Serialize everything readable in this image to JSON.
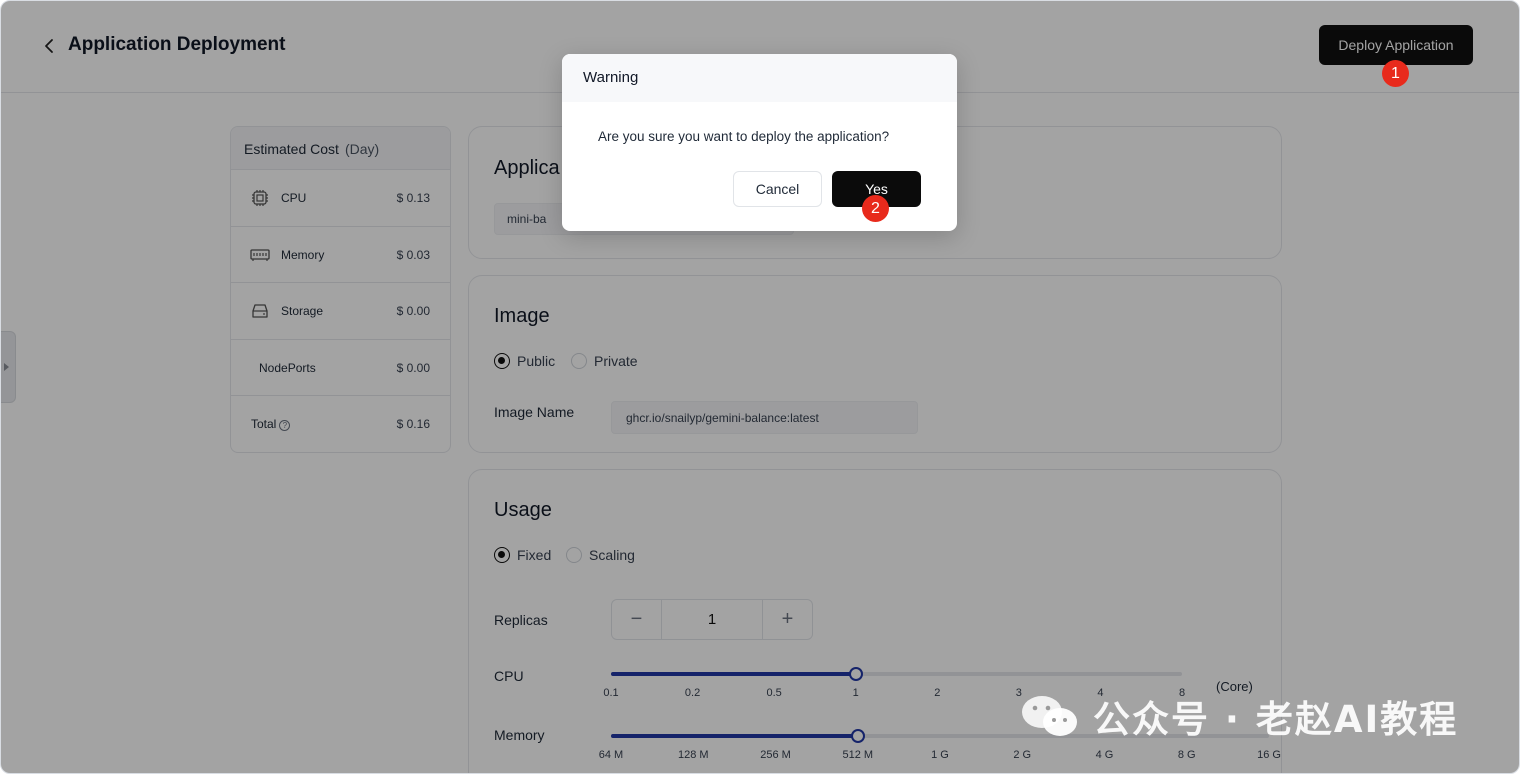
{
  "header": {
    "title": "Application Deployment",
    "deploy_label": "Deploy Application"
  },
  "cost": {
    "title": "Estimated Cost",
    "unit": "(Day)",
    "rows": [
      {
        "label": "CPU",
        "value": "$ 0.13",
        "icon": "cpu-chip-icon"
      },
      {
        "label": "Memory",
        "value": "$ 0.03",
        "icon": "memory-module-icon"
      },
      {
        "label": "Storage",
        "value": "$ 0.00",
        "icon": "storage-drive-icon"
      },
      {
        "label": "NodePorts",
        "value": "$ 0.00"
      },
      {
        "label": "Total",
        "value": "$ 0.16",
        "icon": "help-circle-icon"
      }
    ]
  },
  "app_card": {
    "title": "Applica",
    "name_value": "mini-ba"
  },
  "image_card": {
    "title": "Image",
    "public_label": "Public",
    "private_label": "Private",
    "selected": "Public",
    "image_name_label": "Image Name",
    "image_name_value": "ghcr.io/snailyp/gemini-balance:latest"
  },
  "usage_card": {
    "title": "Usage",
    "fixed_label": "Fixed",
    "scaling_label": "Scaling",
    "selected": "Fixed",
    "replicas_label": "Replicas",
    "replicas_value": "1",
    "cpu_label": "CPU",
    "cpu_unit": "(Core)",
    "cpu_ticks": [
      "0.1",
      "0.2",
      "0.5",
      "1",
      "2",
      "3",
      "4",
      "8"
    ],
    "cpu_selected": "1",
    "memory_label": "Memory",
    "memory_ticks": [
      "64 M",
      "128 M",
      "256 M",
      "512 M",
      "1 G",
      "2 G",
      "4 G",
      "8 G",
      "16 G"
    ],
    "memory_selected": "512 M"
  },
  "modal": {
    "title": "Warning",
    "message": "Are you sure you want to deploy the application?",
    "cancel_label": "Cancel",
    "yes_label": "Yes"
  },
  "badges": {
    "step1": "1",
    "step2": "2"
  },
  "watermark": {
    "text": "公众号 · 老赵AI教程"
  },
  "colors": {
    "accent": "#2137a6",
    "primary_button": "#111111",
    "badge": "#e82a1c"
  }
}
